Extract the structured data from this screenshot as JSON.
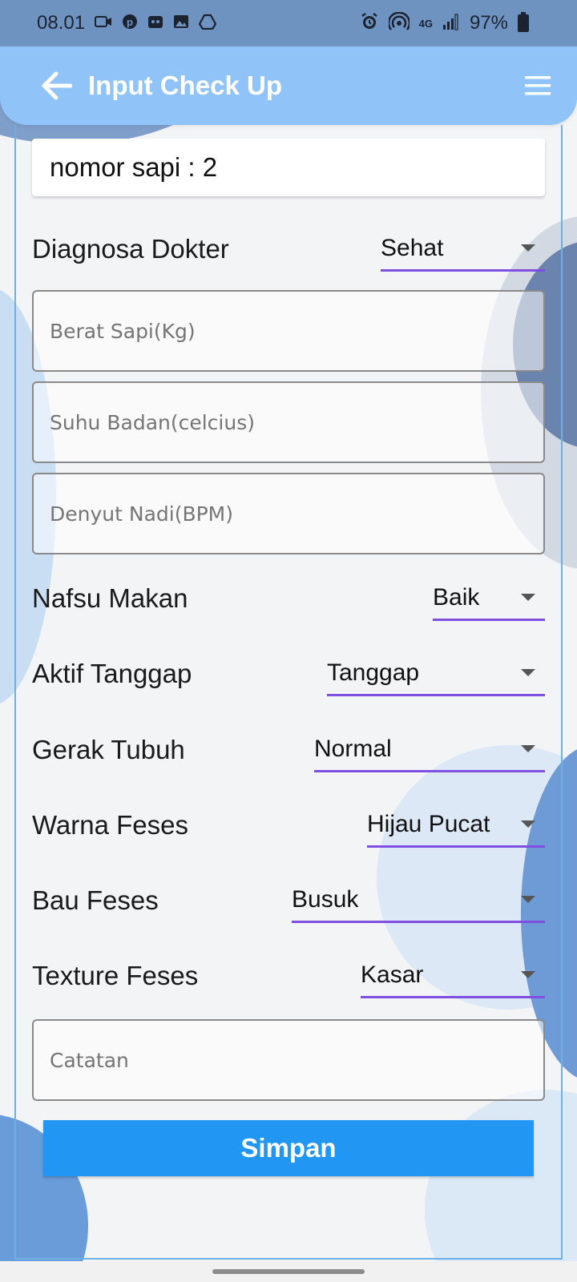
{
  "status_bar": {
    "time": "08.01",
    "battery": "97%",
    "network": "4G"
  },
  "app_bar": {
    "title": "Input Check Up"
  },
  "form": {
    "cow_number": "nomor sapi : 2",
    "diagnosa": {
      "label": "Diagnosa Dokter",
      "value": "Sehat"
    },
    "weight": {
      "placeholder": "Berat Sapi(Kg)"
    },
    "temperature": {
      "placeholder": "Suhu Badan(celcius)"
    },
    "pulse": {
      "placeholder": "Denyut Nadi(BPM)"
    },
    "appetite": {
      "label": "Nafsu Makan",
      "value": "Baik"
    },
    "responsive": {
      "label": "Aktif Tanggap",
      "value": "Tanggap"
    },
    "movement": {
      "label": "Gerak Tubuh",
      "value": "Normal"
    },
    "feces_color": {
      "label": "Warna Feses",
      "value": "Hijau Pucat"
    },
    "feces_smell": {
      "label": "Bau Feses",
      "value": "Busuk"
    },
    "feces_texture": {
      "label": "Texture Feses",
      "value": "Kasar"
    },
    "notes": {
      "placeholder": "Catatan"
    },
    "save_label": "Simpan"
  },
  "colors": {
    "status_bar": "#6f93c1",
    "app_bar": "#90c4f9",
    "accent_underline": "#7e4fe0",
    "save_button": "#2196f3",
    "card_border": "#6cb0e6"
  }
}
